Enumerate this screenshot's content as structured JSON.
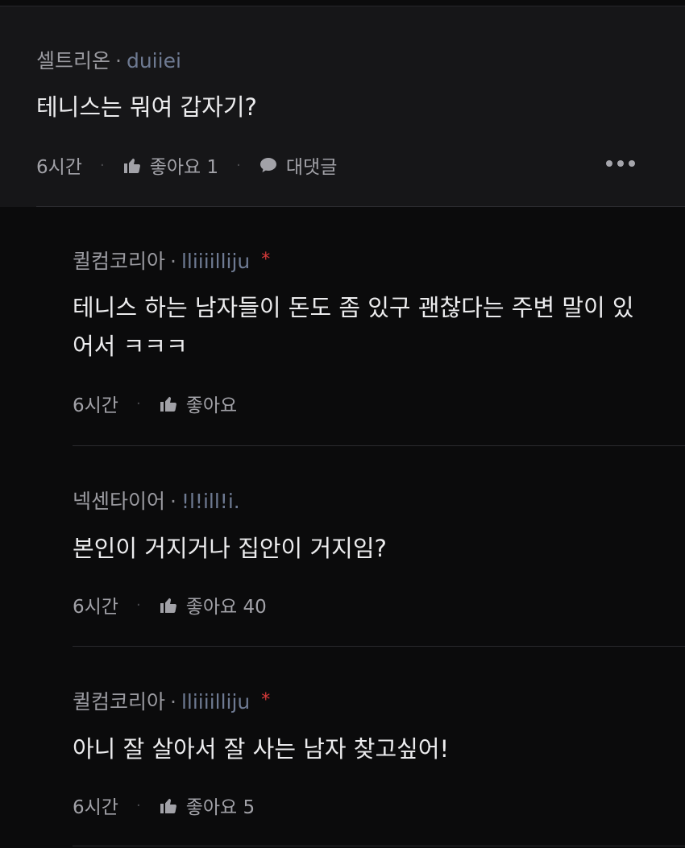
{
  "parent": {
    "author": "셀트리온",
    "user_id": "duiiei",
    "text": "테니스는 뭐여 갑자기?",
    "time": "6시간",
    "like_label": "좋아요 1",
    "reply_label": "대댓글"
  },
  "replies": [
    {
      "author": "퀼컴코리아",
      "user_id": "lliiiilliju",
      "star": "*",
      "text": "테니스 하는 남자들이 돈도 좀 있구 괜찮다는 주변 말이 있어서 ㅋㅋㅋ",
      "time": "6시간",
      "like_label": "좋아요"
    },
    {
      "author": "넥센타이어",
      "user_id": "!l!ill!i.",
      "text": "본인이 거지거나 집안이 거지임?",
      "time": "6시간",
      "like_label": "좋아요 40"
    },
    {
      "author": "퀼컴코리아",
      "user_id": "lliiiilliju",
      "star": "*",
      "text": "아니 잘 살아서 잘 사는 남자 찾고싶어!",
      "time": "6시간",
      "like_label": "좋아요 5"
    }
  ],
  "separator_dot": "·",
  "colors": {
    "background": "#0b0b0c",
    "parent_bg": "#161618",
    "user_id": "#6e7a92",
    "star": "#d63a3a"
  }
}
